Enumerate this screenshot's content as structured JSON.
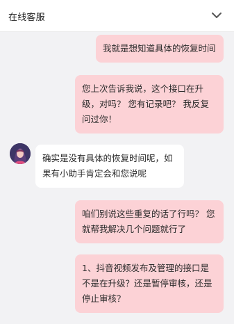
{
  "header": {
    "title": "在线客服",
    "collapse_icon": "chevron-down-icon"
  },
  "avatar": {
    "icon": "agent-avatar"
  },
  "messages": [
    {
      "from": "user",
      "text": "我就是想知道具体的恢复时间"
    },
    {
      "from": "user",
      "text": "您上次告诉我说，这个接口在升级，对吗？ 您有记录吧？ 我反复问过你！"
    },
    {
      "from": "agent",
      "text": "确实是没有具体的恢复时间呢，如果有小助手肯定会和您说呢"
    },
    {
      "from": "user",
      "text": "咱们别说这些重复的话了行吗？ 您就帮我解决几个问题就行了"
    },
    {
      "from": "user",
      "text": "1、抖音视频发布及管理的接口是不是在升级？还是暂停审核，还是停止审核？"
    }
  ],
  "colors": {
    "user_bubble": "#fcd2d6",
    "agent_bubble": "#ffffff",
    "background": "#f2f2f4"
  }
}
